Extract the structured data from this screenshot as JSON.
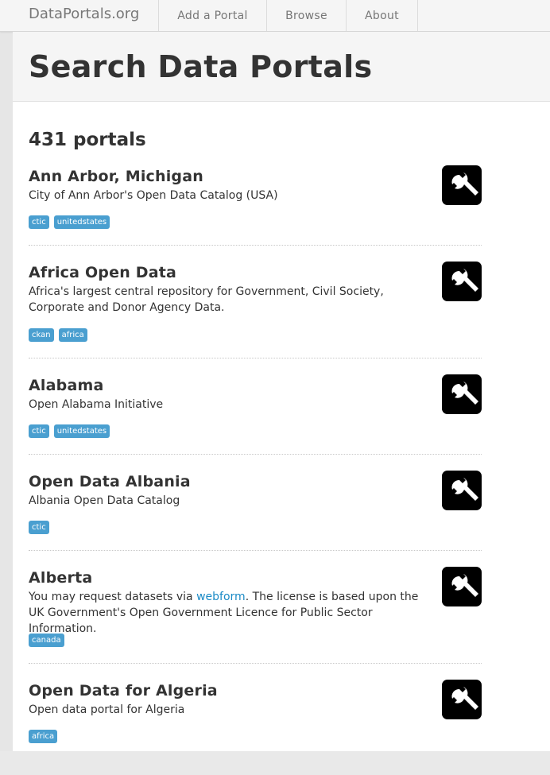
{
  "site": {
    "brand": "DataPortals.org"
  },
  "nav": {
    "add": "Add a Portal",
    "browse": "Browse",
    "about": "About"
  },
  "page": {
    "title": "Search Data Portals",
    "count": "431 portals"
  },
  "portals": [
    {
      "title": "Ann Arbor, Michigan",
      "desc": "City of Ann Arbor's Open Data Catalog (USA)",
      "tags": [
        "ctic",
        "unitedstates"
      ]
    },
    {
      "title": "Africa Open Data",
      "desc": "Africa's largest central repository for Government, Civil Society, Corporate and Donor Agency Data.",
      "tags": [
        "ckan",
        "africa"
      ]
    },
    {
      "title": "Alabama",
      "desc": "Open Alabama Initiative",
      "tags": [
        "ctic",
        "unitedstates"
      ]
    },
    {
      "title": "Open Data Albania",
      "desc": "Albania Open Data Catalog",
      "tags": [
        "ctic"
      ]
    },
    {
      "title": "Alberta",
      "desc_before": "You may request datasets via ",
      "desc_link": "webform",
      "desc_after": ". The license is based upon the UK Government's Open Government Licence for Public Sector Information.",
      "tags": [
        "canada"
      ]
    },
    {
      "title": "Open Data for Algeria",
      "desc": "Open data portal for Algeria",
      "tags": [
        "africa"
      ]
    }
  ],
  "icons": {
    "portal_logo": "wrench-icon"
  },
  "colors": {
    "tag": "#4a9fd0",
    "link": "#1a8ac6"
  }
}
